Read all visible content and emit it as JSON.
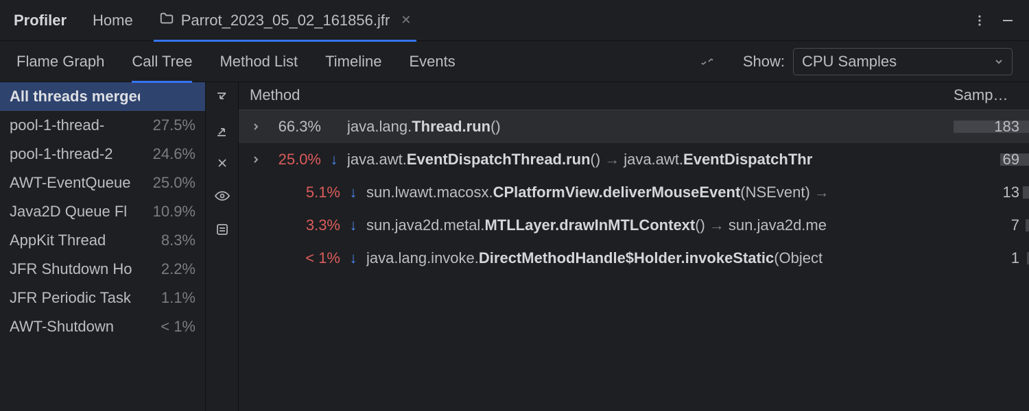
{
  "header": {
    "profiler_label": "Profiler",
    "home_tab": "Home",
    "file_tab_name": "Parrot_2023_05_02_161856.jfr"
  },
  "view_tabs": [
    "Flame Graph",
    "Call Tree",
    "Method List",
    "Timeline",
    "Events"
  ],
  "active_view_tab": 1,
  "show_label": "Show:",
  "show_value": "CPU Samples",
  "threads": [
    {
      "name": "All threads merged",
      "pct": ""
    },
    {
      "name": "pool-1-thread-",
      "pct": "27.5%"
    },
    {
      "name": "pool-1-thread-2",
      "pct": "24.6%"
    },
    {
      "name": "AWT-EventQueue",
      "pct": "25.0%"
    },
    {
      "name": "Java2D Queue Fl",
      "pct": "10.9%"
    },
    {
      "name": "AppKit Thread",
      "pct": "8.3%"
    },
    {
      "name": "JFR Shutdown Ho",
      "pct": "2.2%"
    },
    {
      "name": "JFR Periodic Task",
      "pct": "1.1%"
    },
    {
      "name": "AWT-Shutdown",
      "pct": "< 1%"
    }
  ],
  "selected_thread": 0,
  "tree_header": {
    "method": "Method",
    "samples": "Samp…"
  },
  "tree": [
    {
      "expandable": true,
      "indent": 0,
      "pct": "66.3%",
      "pct_red": false,
      "recur": false,
      "pkg": "java.lang.",
      "cls": "Thread.run",
      "args": "()",
      "chain_pkg": "",
      "chain_cls": "",
      "samples": "183",
      "bar_pct": 100,
      "highlight": true
    },
    {
      "expandable": true,
      "indent": 0,
      "pct": "25.0%",
      "pct_red": true,
      "recur": true,
      "pkg": "java.awt.",
      "cls": "EventDispatchThread.run",
      "args": "()",
      "chain_pkg": "java.awt.",
      "chain_cls": "EventDispatchThr",
      "samples": "69",
      "bar_pct": 38,
      "highlight": false
    },
    {
      "expandable": false,
      "indent": 1,
      "pct": "5.1%",
      "pct_red": true,
      "recur": true,
      "pkg": "sun.lwawt.macosx.",
      "cls": "CPlatformView.deliverMouseEvent",
      "args": "(NSEvent)",
      "chain_pkg": "",
      "chain_cls": "",
      "has_arrow_only": true,
      "samples": "13",
      "bar_pct": 8,
      "highlight": false
    },
    {
      "expandable": false,
      "indent": 1,
      "pct": "3.3%",
      "pct_red": true,
      "recur": true,
      "pkg": "sun.java2d.metal.",
      "cls": "MTLLayer.drawInMTLContext",
      "args": "()",
      "chain_pkg": "sun.java2d.me",
      "chain_cls": "",
      "samples": "7",
      "bar_pct": 5,
      "highlight": false
    },
    {
      "expandable": false,
      "indent": 1,
      "pct": "< 1%",
      "pct_red": true,
      "recur": true,
      "pkg": "java.lang.invoke.",
      "cls": "DirectMethodHandle$Holder.invokeStatic",
      "args": "(Object",
      "chain_pkg": "",
      "chain_cls": "",
      "samples": "1",
      "bar_pct": 3,
      "highlight": false
    }
  ]
}
